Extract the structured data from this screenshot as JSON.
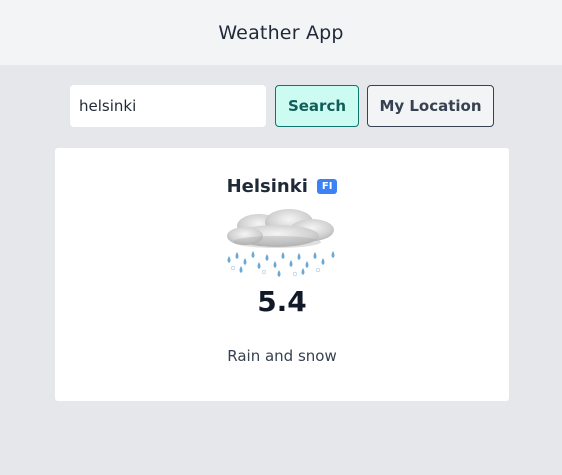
{
  "header": {
    "title": "Weather App"
  },
  "search": {
    "value": "helsinki",
    "button_label": "Search"
  },
  "location_button": {
    "label": "My Location"
  },
  "weather": {
    "city": "Helsinki",
    "country_code": "FI",
    "temperature": "5.4",
    "description": "Rain and snow",
    "icon": "rain-snow-cloud-icon"
  },
  "colors": {
    "page_bg": "#e5e7eb",
    "header_bg": "#f3f4f6",
    "search_button_bg": "#ccfbf1",
    "search_button_border": "#0f766e",
    "badge_bg": "#3b82f6"
  }
}
